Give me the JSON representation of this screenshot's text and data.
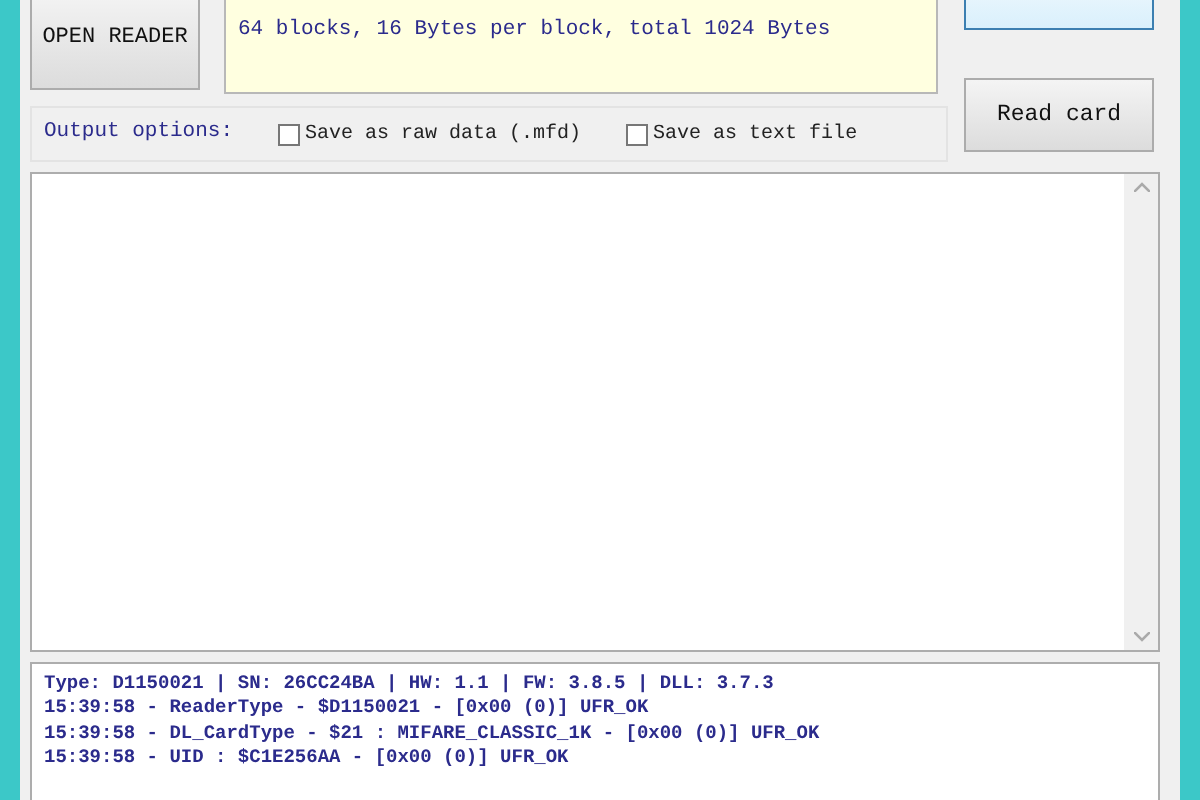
{
  "reader_button": {
    "label": "OPEN READER"
  },
  "card_info": {
    "lines": [
      "64 blocks, 16 Bytes per block, total 1024 Bytes"
    ]
  },
  "read_card_button": {
    "label": "Read card"
  },
  "output_options": {
    "label": "Output options:",
    "checkboxes": [
      {
        "label": "Save as raw data (.mfd)",
        "checked": false
      },
      {
        "label": "Save as text file",
        "checked": false
      }
    ]
  },
  "log": [
    "Type: D1150021 | SN: 26CC24BA | HW: 1.1 | FW: 3.8.5 | DLL: 3.7.3",
    "15:39:58 - ReaderType - $D1150021 - [0x00 (0)] UFR_OK",
    "15:39:58 - DL_CardType - $21 : MIFARE_CLASSIC_1K - [0x00 (0)] UFR_OK",
    "15:39:58 - UID : $C1E256AA - [0x00 (0)] UFR_OK"
  ]
}
